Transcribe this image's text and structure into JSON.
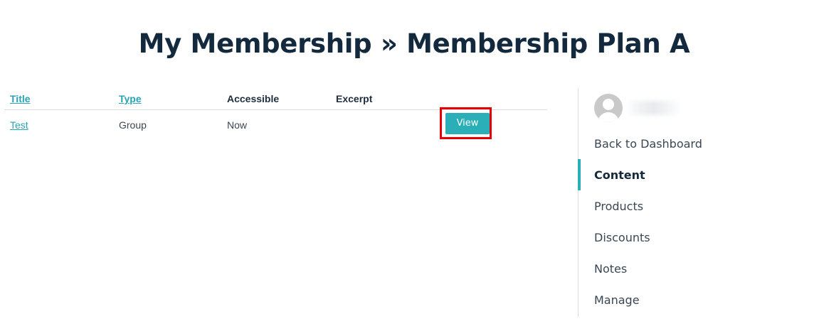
{
  "page": {
    "title": "My Membership » Membership Plan A"
  },
  "table": {
    "columns": [
      {
        "label": "Title",
        "sortable": true
      },
      {
        "label": "Type",
        "sortable": true
      },
      {
        "label": "Accessible",
        "sortable": false
      },
      {
        "label": "Excerpt",
        "sortable": false
      }
    ],
    "rows": [
      {
        "title": "Test",
        "type": "Group",
        "accessible": "Now",
        "excerpt": "",
        "action_label": "View"
      }
    ]
  },
  "sidebar": {
    "username": "",
    "nav": [
      {
        "label": "Back to Dashboard",
        "active": false
      },
      {
        "label": "Content",
        "active": true
      },
      {
        "label": "Products",
        "active": false
      },
      {
        "label": "Discounts",
        "active": false
      },
      {
        "label": "Notes",
        "active": false
      },
      {
        "label": "Manage",
        "active": false
      }
    ]
  },
  "colors": {
    "accent": "#2aaeb7",
    "link": "#2aa3b4",
    "heading": "#13293d",
    "highlight_box": "#e60000"
  },
  "icons": {
    "avatar": "user-avatar-icon"
  }
}
